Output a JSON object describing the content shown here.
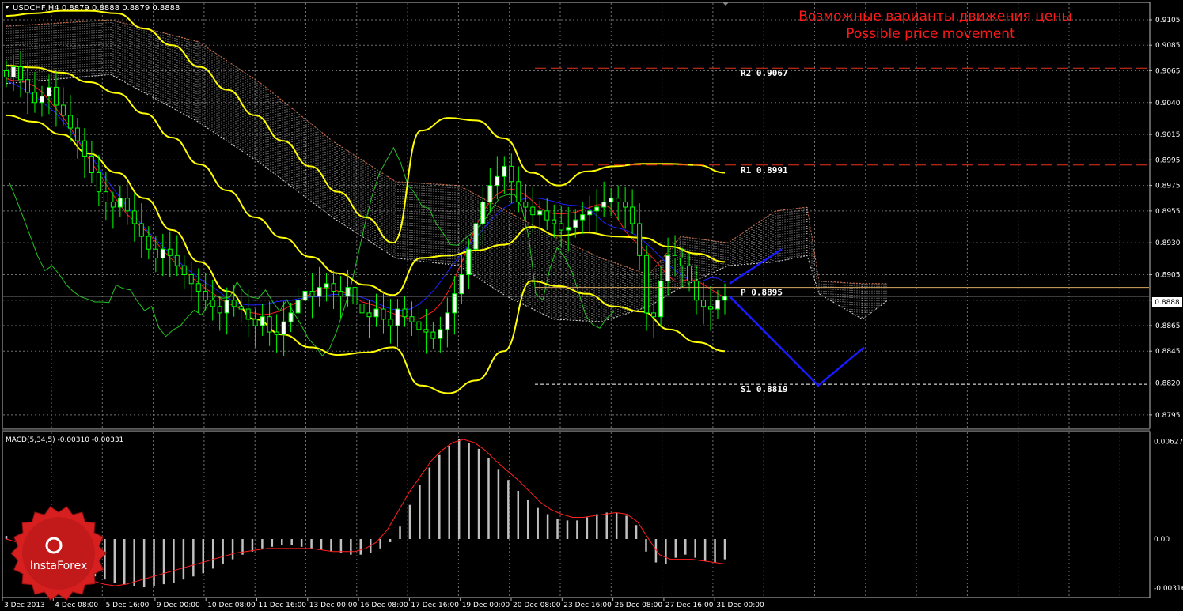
{
  "header": {
    "symbol_info": "USDCHF,H4  0.8879 0.8888 0.8879 0.8888",
    "annotation_ru": "Возможные варианты движения цены",
    "annotation_en": "Possible price movement"
  },
  "macd_header": "MACD(5,34,5) -0.00310 -0.00331",
  "logo": "InstaForex",
  "chart_data": {
    "type": "candlestick",
    "instrument": "USDCHF",
    "timeframe": "H4",
    "price_axis": {
      "range": [
        0.8785,
        0.9118
      ],
      "ticks": [
        "0.9105",
        "0.9085",
        "0.9065",
        "0.9040",
        "0.9015",
        "0.8995",
        "0.8975",
        "0.8955",
        "0.8930",
        "0.8905",
        "0.8885",
        "0.8865",
        "0.8845",
        "0.8820",
        "0.8795"
      ]
    },
    "current_price": "0.8888",
    "levels": [
      {
        "name": "R2",
        "label": "R2  0.9067",
        "value": 0.9067,
        "color": "#e8341c"
      },
      {
        "name": "R1",
        "label": "R1  0.8991",
        "value": 0.8991,
        "color": "#e8341c"
      },
      {
        "name": "P",
        "label": "P  0.8895",
        "value": 0.8895,
        "color": "#d8a860"
      },
      {
        "name": "S1",
        "label": "S1  0.8819",
        "value": 0.8819,
        "color": "#ffffff"
      }
    ],
    "time_axis": [
      "3 Dec 2013",
      "4 Dec 08:00",
      "5 Dec 16:00",
      "9 Dec 00:00",
      "10 Dec 08:00",
      "11 Dec 16:00",
      "13 Dec 00:00",
      "16 Dec 08:00",
      "17 Dec 16:00",
      "19 Dec 00:00",
      "20 Dec 08:00",
      "23 Dec 16:00",
      "26 Dec 08:00",
      "27 Dec 16:00",
      "31 Dec 00:00"
    ],
    "closes": [
      0.906,
      0.9068,
      0.9058,
      0.9048,
      0.904,
      0.9045,
      0.9052,
      0.9038,
      0.903,
      0.902,
      0.901,
      0.8998,
      0.8985,
      0.897,
      0.8962,
      0.8958,
      0.8965,
      0.8955,
      0.8945,
      0.8935,
      0.8925,
      0.8918,
      0.8925,
      0.892,
      0.8912,
      0.8905,
      0.8898,
      0.8892,
      0.8885,
      0.888,
      0.8875,
      0.8885,
      0.888,
      0.8878,
      0.887,
      0.8865,
      0.8872,
      0.886,
      0.8858,
      0.8868,
      0.8875,
      0.8885,
      0.8892,
      0.8888,
      0.8895,
      0.8898,
      0.8892,
      0.8888,
      0.8895,
      0.8882,
      0.8875,
      0.8872,
      0.8878,
      0.887,
      0.8865,
      0.8878,
      0.8872,
      0.8868,
      0.8862,
      0.886,
      0.8855,
      0.8862,
      0.8875,
      0.889,
      0.8905,
      0.8925,
      0.8945,
      0.8962,
      0.8975,
      0.8982,
      0.899,
      0.8978,
      0.8962,
      0.8958,
      0.8952,
      0.8955,
      0.8948,
      0.8945,
      0.894,
      0.8942,
      0.8948,
      0.8952,
      0.8955,
      0.8958,
      0.8962,
      0.8965,
      0.8962,
      0.8958,
      0.8945,
      0.892,
      0.8875,
      0.8872,
      0.89,
      0.892,
      0.8918,
      0.8912,
      0.89,
      0.8885,
      0.888,
      0.8878,
      0.8885,
      0.8888
    ],
    "bollinger_upper": [
      0.9108,
      0.911,
      0.9112,
      0.9112,
      0.911,
      0.9098,
      0.9085,
      0.9068,
      0.905,
      0.903,
      0.901,
      0.899,
      0.897,
      0.895,
      0.893,
      0.9018,
      0.9028,
      0.9026,
      0.9012,
      0.8985,
      0.8975,
      0.8986,
      0.899,
      0.8992,
      0.8992,
      0.8991,
      0.8985
    ],
    "bollinger_lower": [
      0.903,
      0.9025,
      0.9015,
      0.9,
      0.8985,
      0.8965,
      0.894,
      0.8915,
      0.8892,
      0.887,
      0.8858,
      0.8848,
      0.8842,
      0.8844,
      0.8848,
      0.8818,
      0.8812,
      0.8822,
      0.8845,
      0.89,
      0.8896,
      0.889,
      0.888,
      0.8876,
      0.8862,
      0.8852,
      0.8845
    ],
    "forecast_path": [
      [
        [
          "31 Dec 00:00",
          0.8898
        ],
        [
          "1 Jan",
          0.8925
        ]
      ],
      [
        [
          "31 Dec 00:00",
          0.8888
        ],
        [
          "1 Jan",
          0.8818
        ],
        [
          "2 Jan",
          0.8848
        ]
      ]
    ],
    "macd": {
      "params": "5,34,5",
      "range": [
        -0.00325,
        0.0064
      ],
      "ticks": [
        "0.00627",
        "0.00",
        "-0.00316"
      ],
      "values": [
        0.0002,
        0.0001,
        -0.0004,
        -0.0008,
        -0.0012,
        -0.0015,
        -0.0018,
        -0.002,
        -0.0022,
        -0.0024,
        -0.0026,
        -0.0028,
        -0.0029,
        -0.003,
        -0.0031,
        -0.003,
        -0.0029,
        -0.0028,
        -0.0026,
        -0.0024,
        -0.0022,
        -0.0019,
        -0.0016,
        -0.0013,
        -0.001,
        -0.0008,
        -0.0006,
        -0.0005,
        -0.0004,
        -0.0004,
        -0.0005,
        -0.0006,
        -0.0007,
        -0.0008,
        -0.0009,
        -0.001,
        -0.001,
        -0.0009,
        -0.0006,
        -0.0002,
        0.0008,
        0.0022,
        0.0035,
        0.0046,
        0.0054,
        0.006,
        0.0064,
        0.0062,
        0.0058,
        0.0052,
        0.0045,
        0.0038,
        0.0031,
        0.0025,
        0.002,
        0.0016,
        0.0013,
        0.0012,
        0.0012,
        0.0014,
        0.0016,
        0.0017,
        0.0017,
        0.0015,
        0.0009,
        -0.0008,
        -0.0015,
        -0.0016,
        -0.0012,
        -0.001,
        -0.0012,
        -0.0014,
        -0.0015,
        -0.0013
      ],
      "signal": [
        0.0,
        -0.0002,
        -0.0005,
        -0.0009,
        -0.0013,
        -0.0017,
        -0.0021,
        -0.0024,
        -0.0027,
        -0.0029,
        -0.003,
        -0.0029,
        -0.0027,
        -0.0025,
        -0.0023,
        -0.0021,
        -0.0019,
        -0.0017,
        -0.0015,
        -0.0013,
        -0.0011,
        -0.0009,
        -0.0008,
        -0.0007,
        -0.0006,
        -0.0006,
        -0.0006,
        -0.0006,
        -0.0006,
        -0.0007,
        -0.0008,
        -0.0008,
        -0.0008,
        -0.0006,
        -0.0002,
        0.0006,
        0.0018,
        0.003,
        0.004,
        0.005,
        0.0057,
        0.0062,
        0.0064,
        0.0062,
        0.0057,
        0.005,
        0.0044,
        0.0038,
        0.0031,
        0.0024,
        0.0019,
        0.0016,
        0.0014,
        0.0014,
        0.0015,
        0.0016,
        0.0017,
        0.0016,
        0.0011,
        0.0,
        -0.001,
        -0.0013,
        -0.0013,
        -0.0013,
        -0.0014,
        -0.0015,
        -0.0016
      ]
    }
  },
  "colors": {
    "background": "#000000",
    "grid": "#6f6f6f",
    "bollinger": "#ffff00",
    "candle": "#00ff00",
    "candle_up": "#ffffff",
    "forecast": "#1a1aff",
    "annotation": "#ff1a1a",
    "macd_bars": "#c0c0c0",
    "macd_signal": "#ff2020",
    "tenkan": "#ff2020",
    "kijun": "#1f1fff",
    "chikou": "#22c422",
    "logo_red": "#d81f1f"
  }
}
